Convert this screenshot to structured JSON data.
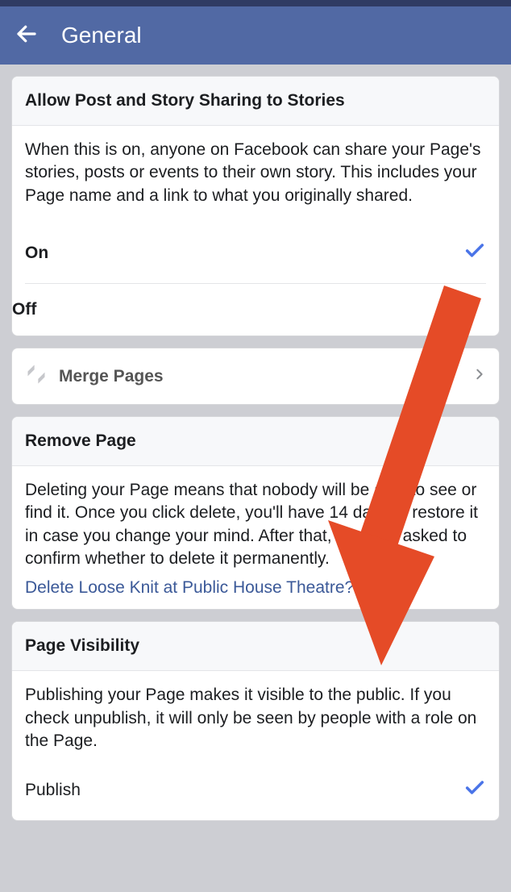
{
  "header": {
    "title": "General"
  },
  "sharing": {
    "header": "Allow Post and Story Sharing to Stories",
    "description": "When this is on, anyone on Facebook can share your Page's stories, posts or events to their own story. This includes your Page name and a link to what you originally shared.",
    "option_on": "On",
    "option_off": "Off",
    "selected": "on"
  },
  "merge": {
    "label": "Merge Pages"
  },
  "remove": {
    "header": "Remove Page",
    "description": "Deleting your Page means that nobody will be able to see or find it. Once you click delete, you'll have 14 days to restore it in case you change your mind. After that, you'll be asked to confirm whether to delete it permanently.",
    "link": "Delete Loose Knit at Public House Theatre?"
  },
  "visibility": {
    "header": "Page Visibility",
    "description": "Publishing your Page makes it visible to the public. If you check unpublish, it will only be seen by people with a role on the Page.",
    "option_publish": "Publish"
  }
}
